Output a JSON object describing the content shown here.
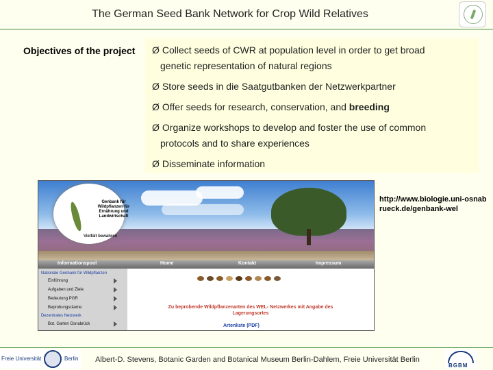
{
  "slide": {
    "title": "The German Seed Bank Network for Crop Wild Relatives",
    "objectives_label": "Objectives of the project",
    "bullet_glyph": "Ø",
    "bullets": [
      {
        "line1": "Collect seeds of CWR at population level in order to get broad",
        "line2": "genetic representation of natural regions"
      },
      {
        "line1": "Store seeds in die Saatgutbanken der Netzwerkpartner"
      },
      {
        "text": "Offer seeds for research, conservation, and ",
        "bold": "breeding"
      },
      {
        "line1": "Organize workshops to develop and foster the use of common",
        "line2": "protocols and to share experiences"
      },
      {
        "line1": "Disseminate information"
      }
    ],
    "url": "http://www.biologie.uni-osnabrueck.de/genbank-wel",
    "footer": "Albert-D. Stevens, Botanic Garden and Botanical Museum Berlin-Dahlem, Freie Universität Berlin"
  },
  "website": {
    "badge_title": "Genbank für Wildpflanzen für Ernährung und Landwirtschaft",
    "badge_sub": "Vielfalt bewahren",
    "nav": [
      "Informationspool",
      "Home",
      "Kontakt",
      "Impressum"
    ],
    "side_head_1": "Nationale Genbank für Wildpflanzen",
    "side_items": [
      "Einführung",
      "Aufgaben und Ziele",
      "Bedeutung PGR",
      "Beprobungsräume"
    ],
    "side_head_2": "Dezentrales Netzwerk",
    "side_item_last": "Bot. Garten Osnabrück",
    "content_title": "Zu beprobende Wildpflanzenarten des WEL- Netzwerkes mit Angabe des Lagerungsortes",
    "content_link": "Artenliste (PDF)"
  },
  "logos": {
    "fu_left": "Freie Universität",
    "fu_right": "Berlin",
    "bgbm": "BGBM"
  }
}
